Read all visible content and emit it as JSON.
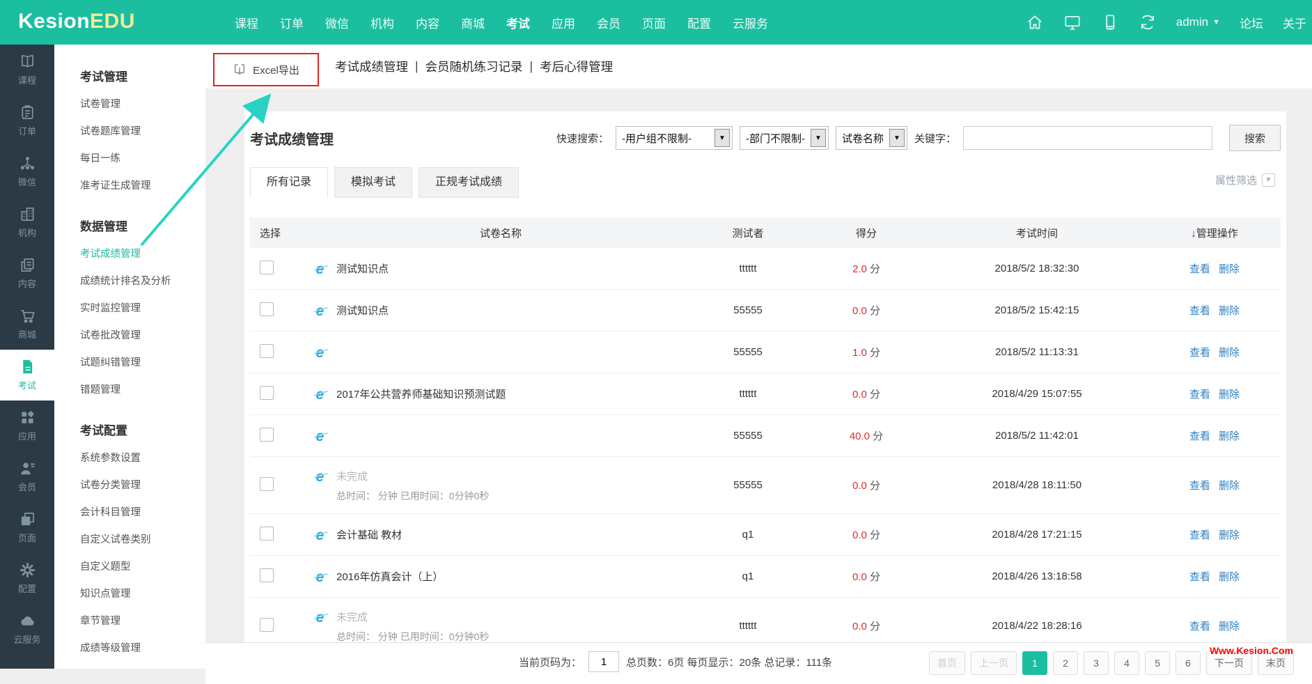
{
  "colors": {
    "accent": "#1cbea0",
    "rail_bg": "#2b3a45",
    "score_red": "#e02b2b",
    "link_blue": "#2e7fc0",
    "annotation_red": "#e02424",
    "annotation_teal": "#29d3c3"
  },
  "topbar": {
    "logo_part1": "Kesion",
    "logo_part2": "EDU",
    "menu": [
      {
        "label": "课程"
      },
      {
        "label": "订单"
      },
      {
        "label": "微信"
      },
      {
        "label": "机构"
      },
      {
        "label": "内容"
      },
      {
        "label": "商城"
      },
      {
        "label": "考试",
        "active": true
      },
      {
        "label": "应用"
      },
      {
        "label": "会员"
      },
      {
        "label": "页面"
      },
      {
        "label": "配置"
      },
      {
        "label": "云服务"
      }
    ],
    "user": "admin",
    "forum": "论坛",
    "about": "关于"
  },
  "rail": {
    "items": [
      {
        "label": "课程"
      },
      {
        "label": "订单"
      },
      {
        "label": "微信"
      },
      {
        "label": "机构"
      },
      {
        "label": "内容"
      },
      {
        "label": "商城"
      },
      {
        "label": "考试",
        "active": true
      },
      {
        "label": "应用"
      },
      {
        "label": "会员"
      },
      {
        "label": "页面"
      },
      {
        "label": "配置"
      },
      {
        "label": "云服务"
      }
    ]
  },
  "sidebar": {
    "groups": [
      {
        "title": "考试管理",
        "items": [
          {
            "label": "试卷管理"
          },
          {
            "label": "试卷题库管理"
          },
          {
            "label": "每日一练"
          },
          {
            "label": "准考证生成管理"
          }
        ]
      },
      {
        "title": "数据管理",
        "items": [
          {
            "label": "考试成绩管理",
            "active": true
          },
          {
            "label": "成绩统计排名及分析"
          },
          {
            "label": "实时监控管理"
          },
          {
            "label": "试卷批改管理"
          },
          {
            "label": "试题纠错管理"
          },
          {
            "label": "错题管理"
          }
        ]
      },
      {
        "title": "考试配置",
        "items": [
          {
            "label": "系统参数设置"
          },
          {
            "label": "试卷分类管理"
          },
          {
            "label": "会计科目管理"
          },
          {
            "label": "自定义试卷类别"
          },
          {
            "label": "自定义题型"
          },
          {
            "label": "知识点管理"
          },
          {
            "label": "章节管理"
          },
          {
            "label": "成绩等级管理"
          }
        ]
      }
    ]
  },
  "toolbar": {
    "export_label": "Excel导出",
    "links": [
      "考试成绩管理",
      "会员随机练习记录",
      "考后心得管理"
    ]
  },
  "panel": {
    "title": "考试成绩管理",
    "filter": {
      "quick_label": "快速搜索：",
      "selects": [
        "-用户组不限制-",
        "-部门不限制-",
        "试卷名称"
      ],
      "keyword_label": "关键字：",
      "keyword_value": "",
      "search_label": "搜索"
    },
    "tabs": [
      {
        "label": "所有记录",
        "active": true
      },
      {
        "label": "模拟考试"
      },
      {
        "label": "正规考试成绩"
      }
    ],
    "attr_filter": "属性筛选",
    "table": {
      "headers": [
        "选择",
        "试卷名称",
        "测试者",
        "得分",
        "考试时间",
        "↓管理操作"
      ],
      "score_suffix": "分",
      "action_view": "查看",
      "action_delete": "删除",
      "rows": [
        {
          "name": "测试知识点",
          "tester": "tttttt",
          "score": "2.0",
          "time": "2018/5/2 18:32:30"
        },
        {
          "name": "测试知识点",
          "tester": "55555",
          "score": "0.0",
          "time": "2018/5/2 15:42:15"
        },
        {
          "name": "",
          "tester": "55555",
          "score": "1.0",
          "time": "2018/5/2 11:13:31"
        },
        {
          "name": "2017年公共营养师基础知识预测试题",
          "tester": "tttttt",
          "score": "0.0",
          "time": "2018/4/29 15:07:55"
        },
        {
          "name": "",
          "tester": "55555",
          "score": "40.0",
          "time": "2018/5/2 11:42:01"
        },
        {
          "name": "未完成",
          "gray": true,
          "sub": "总时间： 分钟 已用时间：0分钟0秒",
          "tester": "55555",
          "score": "0.0",
          "time": "2018/4/28 18:11:50"
        },
        {
          "name": "会计基础 教材",
          "tester": "q1",
          "score": "0.0",
          "time": "2018/4/28 17:21:15"
        },
        {
          "name": "2016年仿真会计（上）",
          "tester": "q1",
          "score": "0.0",
          "time": "2018/4/26 13:18:58"
        },
        {
          "name": "未完成",
          "gray": true,
          "sub": "总时间： 分钟 已用时间：0分钟0秒",
          "tester": "tttttt",
          "score": "0.0",
          "time": "2018/4/22 18:28:16"
        }
      ]
    }
  },
  "pagination": {
    "current_label": "当前页码为：",
    "current": "1",
    "stats": "总页数：6页 每页显示：20条 总记录：111条",
    "buttons": [
      {
        "label": "首页",
        "state": "disabled"
      },
      {
        "label": "上一页",
        "state": "disabled"
      },
      {
        "label": "1",
        "state": "active"
      },
      {
        "label": "2"
      },
      {
        "label": "3"
      },
      {
        "label": "4"
      },
      {
        "label": "5"
      },
      {
        "label": "6"
      },
      {
        "label": "下一页"
      },
      {
        "label": "末页"
      }
    ]
  },
  "watermark": "Www.Kesion.Com"
}
